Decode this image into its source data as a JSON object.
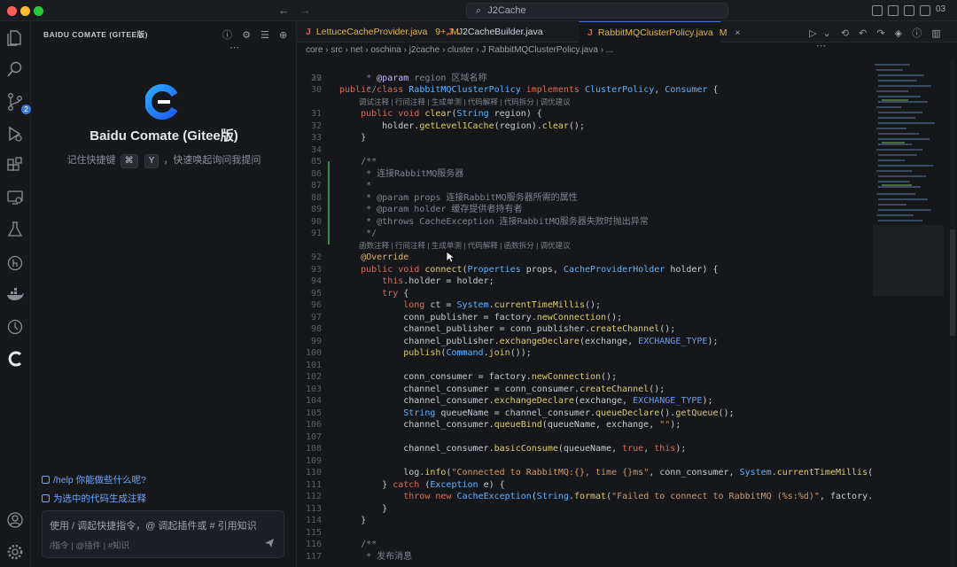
{
  "window": {
    "title": "J2Cache",
    "user_count": "03"
  },
  "activity_bar": {
    "items": [
      {
        "name": "explorer-icon"
      },
      {
        "name": "search-icon"
      },
      {
        "name": "source-control-icon",
        "badge": "2"
      },
      {
        "name": "run-debug-icon"
      },
      {
        "name": "extensions-icon"
      },
      {
        "name": "remote-explorer-icon"
      },
      {
        "name": "testing-icon"
      },
      {
        "name": "git-lens-icon"
      },
      {
        "name": "docker-icon"
      },
      {
        "name": "timeline-icon"
      },
      {
        "name": "comate-icon"
      },
      {
        "name": "account-icon"
      },
      {
        "name": "settings-gear-icon"
      }
    ]
  },
  "panel": {
    "title": "BAIDU COMATE (GITEE版)",
    "brand": "Baidu Comate (Gitee版)",
    "hint_prefix": "记住快捷键",
    "key1": "⌘",
    "key2": "Y",
    "hint_suffix": "，快速唤起询问我提问",
    "suggestions": [
      "/help 你能做些什么呢?",
      "为选中的代码生成注释"
    ],
    "input_placeholder": "使用 / 调起快捷指令，@ 调起插件或 # 引用知识",
    "input_tools": "/指令   |   @插件   |   #知识"
  },
  "tabs": [
    {
      "label": "LettuceCacheProvider.java",
      "status": "9+, M",
      "color": "#e0b64e",
      "active": false
    },
    {
      "label": "J2CacheBuilder.java",
      "status": "",
      "color": "#c8ccd3",
      "active": false
    },
    {
      "label": "RabbitMQClusterPolicy.java",
      "status": "M",
      "color": "#e0b64e",
      "active": true
    }
  ],
  "breadcrumb": "core  ›  src  ›  net  ›  oschina  ›  j2cache  ›  cluster  ›  J  RabbitMQClusterPolicy.java  ›  ...",
  "code": {
    "sticky": "public class RabbitMQClusterPolicy implements ClusterPolicy, Consumer {",
    "code_lens_1": "调试注释 | 行间注释 | 生成单测 | 代码解释 | 代码拆分 | 调优建议",
    "code_lens_2": "函数注释 | 行间注释 | 生成单测 | 代码解释 | 函数拆分 | 调优建议",
    "lines": [
      {
        "n": "29",
        "t": "     * @param region 区域名称"
      },
      {
        "n": "30",
        "t": "     */"
      },
      {
        "n": "31",
        "t": "    public void clear(String region) {"
      },
      {
        "n": "32",
        "t": "        holder.getLevel1Cache(region).clear();"
      },
      {
        "n": "33",
        "t": "    }"
      },
      {
        "n": "34",
        "t": ""
      },
      {
        "n": "85",
        "t": "    /**"
      },
      {
        "n": "86",
        "t": "     * 连接RabbitMQ服务器"
      },
      {
        "n": "87",
        "t": "     *"
      },
      {
        "n": "88",
        "t": "     * @param props 连接RabbitMQ服务器所需的属性"
      },
      {
        "n": "89",
        "t": "     * @param holder 缓存提供者持有者"
      },
      {
        "n": "90",
        "t": "     * @throws CacheException 连接RabbitMQ服务器失败时抛出异常"
      },
      {
        "n": "91",
        "t": "     */"
      },
      {
        "n": "92",
        "t": "    @Override"
      },
      {
        "n": "93",
        "t": "    public void connect(Properties props, CacheProviderHolder holder) {"
      },
      {
        "n": "94",
        "t": "        this.holder = holder;"
      },
      {
        "n": "95",
        "t": "        try {"
      },
      {
        "n": "96",
        "t": "            long ct = System.currentTimeMillis();"
      },
      {
        "n": "97",
        "t": "            conn_publisher = factory.newConnection();"
      },
      {
        "n": "98",
        "t": "            channel_publisher = conn_publisher.createChannel();"
      },
      {
        "n": "99",
        "t": "            channel_publisher.exchangeDeclare(exchange, EXCHANGE_TYPE);"
      },
      {
        "n": "100",
        "t": "            publish(Command.join());"
      },
      {
        "n": "101",
        "t": ""
      },
      {
        "n": "102",
        "t": "            conn_consumer = factory.newConnection();"
      },
      {
        "n": "103",
        "t": "            channel_consumer = conn_consumer.createChannel();"
      },
      {
        "n": "104",
        "t": "            channel_consumer.exchangeDeclare(exchange, EXCHANGE_TYPE);"
      },
      {
        "n": "105",
        "t": "            String queueName = channel_consumer.queueDeclare().getQueue();"
      },
      {
        "n": "106",
        "t": "            channel_consumer.queueBind(queueName, exchange, \"\");"
      },
      {
        "n": "107",
        "t": ""
      },
      {
        "n": "108",
        "t": "            channel_consumer.basicConsume(queueName, true, this);"
      },
      {
        "n": "109",
        "t": ""
      },
      {
        "n": "110",
        "t": "            log.info(\"Connected to RabbitMQ:{}, time {}ms\", conn_consumer, System.currentTimeMillis()-ct);"
      },
      {
        "n": "111",
        "t": "        } catch (Exception e) {"
      },
      {
        "n": "112",
        "t": "            throw new CacheException(String.format(\"Failed to connect to RabbitMQ (%s:%d)\", factory.getHost(),"
      },
      {
        "n": "113",
        "t": "        }"
      },
      {
        "n": "114",
        "t": "    }"
      },
      {
        "n": "115",
        "t": ""
      },
      {
        "n": "116",
        "t": "    /**"
      },
      {
        "n": "117",
        "t": "     * 发布消息"
      }
    ]
  }
}
